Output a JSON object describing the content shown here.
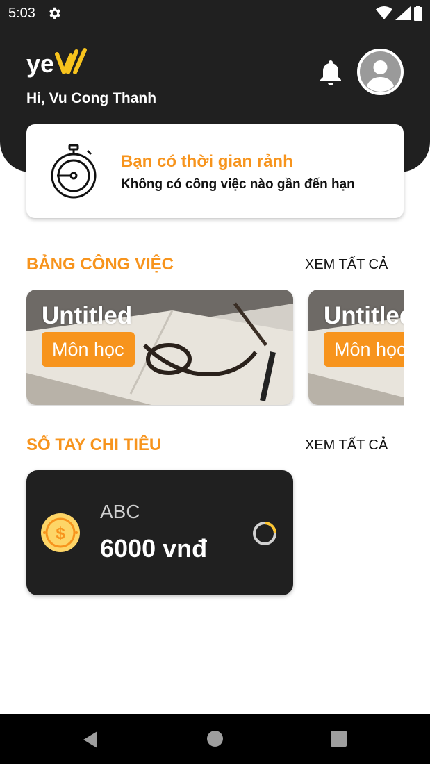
{
  "status_bar": {
    "time": "5:03",
    "icons": [
      "gear-icon",
      "wifi-icon",
      "signal-icon",
      "battery-icon"
    ]
  },
  "header": {
    "logo_text": "yeW",
    "greeting": "Hi, Vu Cong Thanh",
    "icons": [
      "bell-icon",
      "avatar-icon"
    ]
  },
  "free_time_card": {
    "title": "Bạn có thời gian rảnh",
    "subtitle": "Không có công việc nào gần đến hạn",
    "icon": "stopwatch-icon"
  },
  "task_board": {
    "title": "BẢNG CÔNG VIỆC",
    "see_all": "XEM TẤT CẢ",
    "cards": [
      {
        "title": "Untitled",
        "tag": "Môn học"
      },
      {
        "title": "Untitled",
        "tag": "Môn học"
      }
    ]
  },
  "expense_book": {
    "title": "SỔ TAY CHI TIÊU",
    "see_all": "XEM TẤT CẢ",
    "items": [
      {
        "name": "ABC",
        "amount": "6000 vnđ",
        "icon": "coin-icon"
      }
    ]
  },
  "colors": {
    "accent": "#f7941d",
    "header_bg": "#202020",
    "coin_fill": "#fdd567",
    "coin_symbol": "#f7941d"
  },
  "nav_bar": {
    "icons": [
      "back-icon",
      "home-icon",
      "recent-apps-icon"
    ]
  }
}
